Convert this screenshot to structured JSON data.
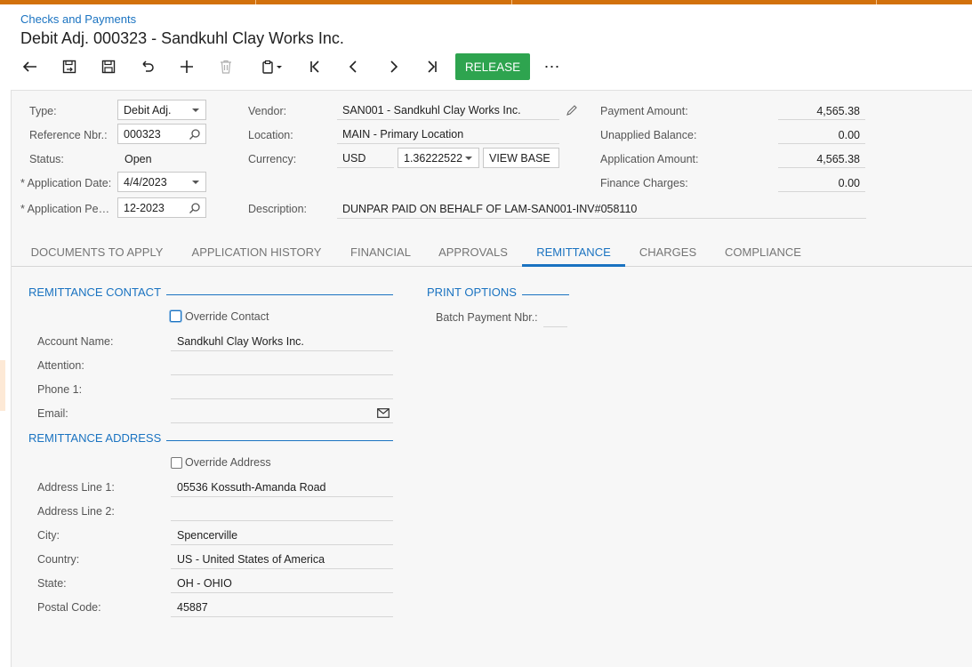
{
  "breadcrumb": "Checks and Payments",
  "title": "Debit Adj. 000323 - Sandkuhl Clay Works Inc.",
  "toolbar": {
    "back_icon": "back-arrow-icon",
    "release_label": "RELEASE",
    "more_label": "⋯"
  },
  "header": {
    "type_label": "Type:",
    "type_value": "Debit Adj.",
    "refnbr_label": "Reference Nbr.:",
    "refnbr_value": "000323",
    "status_label": "Status:",
    "status_value": "Open",
    "appdate_label": "Application Date:",
    "appdate_value": "4/4/2023",
    "appperiod_label": "Application Pe…",
    "appperiod_value": "12-2023",
    "required_mark": "*",
    "vendor_label": "Vendor:",
    "vendor_value": "SAN001 - Sandkuhl Clay Works Inc.",
    "location_label": "Location:",
    "location_value": "MAIN - Primary Location",
    "currency_label": "Currency:",
    "currency_value": "USD",
    "rate_value": "1.36222522",
    "viewbase_label": "VIEW BASE",
    "description_label": "Description:",
    "description_value": "DUNPAR PAID ON BEHALF OF LAM-SAN001-INV#058110",
    "payment_amount_label": "Payment Amount:",
    "payment_amount_value": "4,565.38",
    "unapplied_label": "Unapplied Balance:",
    "unapplied_value": "0.00",
    "application_amount_label": "Application Amount:",
    "application_amount_value": "4,565.38",
    "finance_charges_label": "Finance Charges:",
    "finance_charges_value": "0.00"
  },
  "tabs": [
    {
      "label": "DOCUMENTS TO APPLY"
    },
    {
      "label": "APPLICATION HISTORY"
    },
    {
      "label": "FINANCIAL"
    },
    {
      "label": "APPROVALS"
    },
    {
      "label": "REMITTANCE"
    },
    {
      "label": "CHARGES"
    },
    {
      "label": "COMPLIANCE"
    }
  ],
  "remittance": {
    "contact_title": "REMITTANCE CONTACT",
    "override_contact_label": "Override Contact",
    "account_name_label": "Account Name:",
    "account_name_value": "Sandkuhl Clay Works Inc.",
    "attention_label": "Attention:",
    "attention_value": "",
    "phone_label": "Phone 1:",
    "phone_value": "",
    "email_label": "Email:",
    "email_value": "",
    "address_title": "REMITTANCE ADDRESS",
    "override_address_label": "Override Address",
    "addr1_label": "Address Line 1:",
    "addr1_value": "05536 Kossuth-Amanda Road",
    "addr2_label": "Address Line 2:",
    "addr2_value": "",
    "city_label": "City:",
    "city_value": "Spencerville",
    "country_label": "Country:",
    "country_value": "US - United States of America",
    "state_label": "State:",
    "state_value": "OH - OHIO",
    "postal_label": "Postal Code:",
    "postal_value": "45887"
  },
  "print_options": {
    "title": "PRINT OPTIONS",
    "batch_label": "Batch Payment Nbr.:",
    "batch_value": ""
  },
  "colors": {
    "accent": "#1a73c1",
    "release": "#2ea44f",
    "topbar": "#d2710c"
  }
}
